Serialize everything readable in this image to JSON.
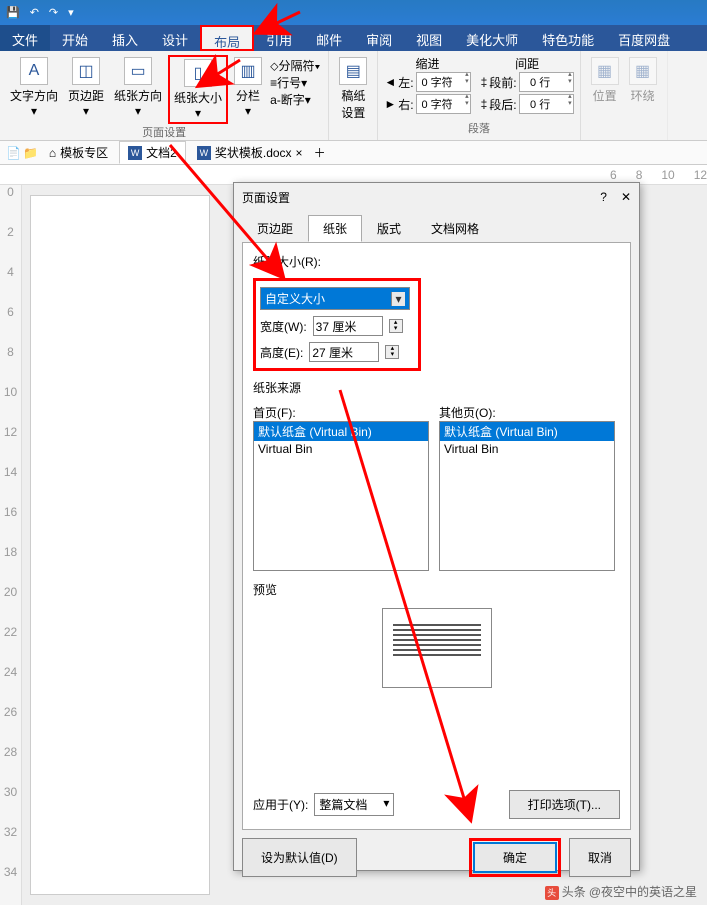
{
  "qat": {
    "save": "💾",
    "undo": "↶",
    "redo": "↷",
    "more": "▾"
  },
  "menu": {
    "file": "文件",
    "home": "开始",
    "insert": "插入",
    "design": "设计",
    "layout": "布局",
    "ref": "引用",
    "mail": "邮件",
    "review": "审阅",
    "view": "视图",
    "beauty": "美化大师",
    "special": "特色功能",
    "baidu": "百度网盘"
  },
  "ribbon": {
    "textdir": "文字方向",
    "margin": "页边距",
    "orient": "纸张方向",
    "size": "纸张大小",
    "columns": "分栏",
    "breaks": "分隔符",
    "lineno": "行号",
    "hyphen": "断字",
    "pagegrp": "页面设置",
    "draft": "稿纸",
    "draftset": "设置",
    "indent": "缩进",
    "left": "左:",
    "right": "右:",
    "val0": "0 字符",
    "spacing": "间距",
    "before": "段前:",
    "after": "段后:",
    "val0l": "0 行",
    "para": "段落",
    "pos": "位置",
    "wrap": "环绕"
  },
  "tabs": {
    "tpl": "模板专区",
    "doc2": "文档2",
    "award": "奖状模板.docx"
  },
  "rulernums": [
    "6",
    "8",
    "10",
    "12"
  ],
  "vruler": [
    "0",
    "2",
    "4",
    "6",
    "8",
    "10",
    "12",
    "14",
    "16",
    "18",
    "20",
    "22",
    "24",
    "26",
    "28",
    "30",
    "32",
    "34"
  ],
  "dlg": {
    "title": "页面设置",
    "help": "?",
    "close": "✕",
    "tabs": {
      "margin": "页边距",
      "paper": "纸张",
      "layout": "版式",
      "grid": "文档网格"
    },
    "sizelbl": "纸张大小(R):",
    "sizesel": "自定义大小",
    "wlbl": "宽度(W):",
    "wval": "37 厘米",
    "hlbl": "高度(E):",
    "hval": "27 厘米",
    "srclbl": "纸张来源",
    "first": "首页(F):",
    "other": "其他页(O):",
    "bin1": "默认纸盒 (Virtual Bin)",
    "bin2": "Virtual Bin",
    "preview": "预览",
    "apply": "应用于(Y):",
    "applysel": "整篇文档",
    "printopt": "打印选项(T)...",
    "default": "设为默认值(D)",
    "ok": "确定",
    "cancel": "取消"
  },
  "attrib": {
    "prefix": "头条",
    "handle": "@夜空中的英语之星"
  }
}
